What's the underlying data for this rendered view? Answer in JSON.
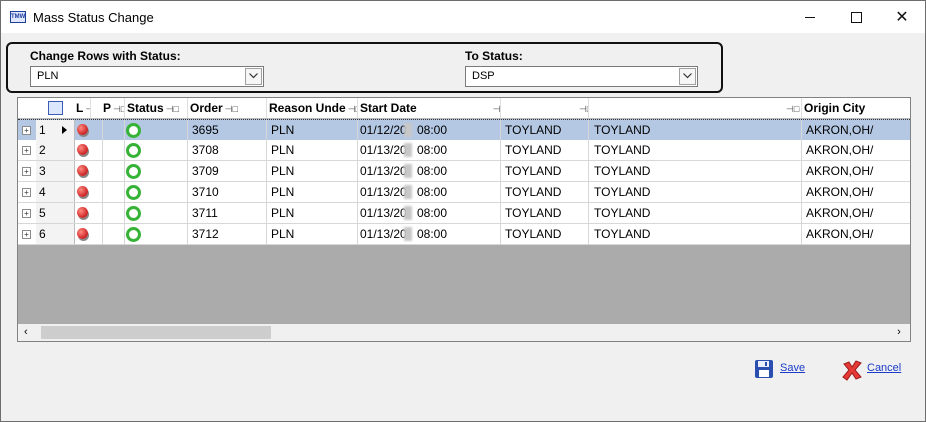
{
  "window": {
    "title": "Mass Status Change",
    "app_icon_text": "TMW",
    "icons": [
      "minimize-icon",
      "maximize-icon",
      "close-icon"
    ]
  },
  "filter": {
    "from_label": "Change Rows with Status:",
    "from_value": "PLN",
    "to_label": "To Status:",
    "to_value": "DSP"
  },
  "grid": {
    "columns": [
      {
        "label": "L"
      },
      {
        "label": "P"
      },
      {
        "label": "Status"
      },
      {
        "label": "Order"
      },
      {
        "label": "Reason Unde"
      },
      {
        "label": "Start Date"
      },
      {
        "label": ""
      },
      {
        "label": ""
      },
      {
        "label": "Origin City"
      }
    ],
    "pin_glyph": "⊣□",
    "rows": [
      {
        "num": "1",
        "order": "3695",
        "reason": "PLN",
        "date": "01/12/20",
        "time": "08:00",
        "c1": "TOYLAND",
        "c2": "TOYLAND",
        "city": "AKRON,OH/",
        "selected": true
      },
      {
        "num": "2",
        "order": "3708",
        "reason": "PLN",
        "date": "01/13/20",
        "time": "08:00",
        "c1": "TOYLAND",
        "c2": "TOYLAND",
        "city": "AKRON,OH/",
        "selected": false
      },
      {
        "num": "3",
        "order": "3709",
        "reason": "PLN",
        "date": "01/13/20",
        "time": "08:00",
        "c1": "TOYLAND",
        "c2": "TOYLAND",
        "city": "AKRON,OH/",
        "selected": false
      },
      {
        "num": "4",
        "order": "3710",
        "reason": "PLN",
        "date": "01/13/20",
        "time": "08:00",
        "c1": "TOYLAND",
        "c2": "TOYLAND",
        "city": "AKRON,OH/",
        "selected": false
      },
      {
        "num": "5",
        "order": "3711",
        "reason": "PLN",
        "date": "01/13/20",
        "time": "08:00",
        "c1": "TOYLAND",
        "c2": "TOYLAND",
        "city": "AKRON,OH/",
        "selected": false
      },
      {
        "num": "6",
        "order": "3712",
        "reason": "PLN",
        "date": "01/13/20",
        "time": "08:00",
        "c1": "TOYLAND",
        "c2": "TOYLAND",
        "city": "AKRON,OH/",
        "selected": false
      }
    ]
  },
  "actions": {
    "save_label": "Save",
    "cancel_label": "Cancel"
  },
  "colors": {
    "selection": "#b4c8e4",
    "link": "#1a3cc8",
    "status_green": "#36b336",
    "pin_red": "#d32f2f"
  }
}
